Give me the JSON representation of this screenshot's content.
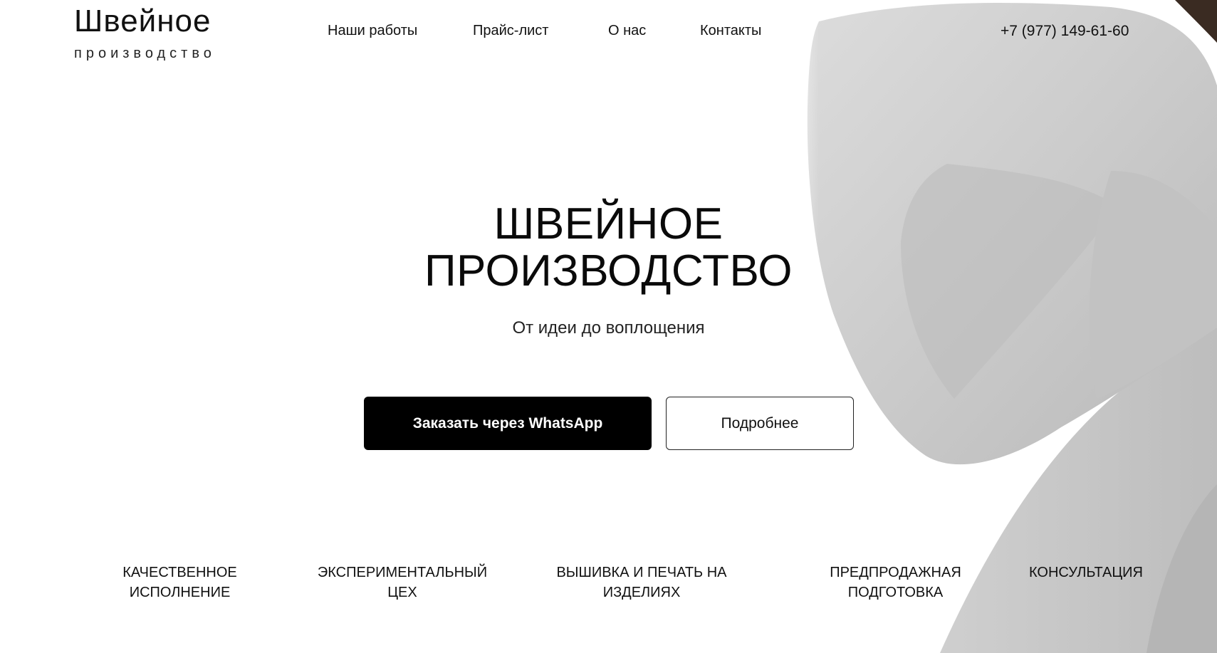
{
  "header": {
    "logo_main": "Швейное",
    "logo_sub": "производство",
    "nav": [
      {
        "label": "Наши работы"
      },
      {
        "label": "Прайс-лист"
      },
      {
        "label": "О нас"
      },
      {
        "label": "Контакты"
      }
    ],
    "phone": "+7 (977) 149-61-60"
  },
  "hero": {
    "title_line1": "ШВЕЙНОЕ",
    "title_line2": "ПРОИЗВОДСТВО",
    "subtitle": "От идеи до воплощения",
    "primary_button": "Заказать через WhatsApp",
    "secondary_button": "Подробнее",
    "image_icon": "hoodie-photo"
  },
  "features": [
    {
      "line1": "КАЧЕСТВЕННОЕ",
      "line2": "ИСПОЛНЕНИЕ"
    },
    {
      "line1": "ЭКСПЕРИМЕНТАЛЬНЫЙ",
      "line2": "ЦЕХ"
    },
    {
      "line1": "ВЫШИВКА И ПЕЧАТЬ НА",
      "line2": "ИЗДЕЛИЯХ"
    },
    {
      "line1": "ПРЕДПРОДАЖНАЯ",
      "line2": "ПОДГОТОВКА"
    },
    {
      "line1": "КОНСУЛЬТАЦИЯ",
      "line2": ""
    }
  ],
  "colors": {
    "background": "#ffffff",
    "text": "#111111",
    "primary_button": "#000000",
    "hoodie": "#c9c9c9"
  }
}
